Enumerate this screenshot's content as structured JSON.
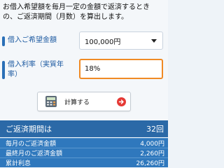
{
  "intro": {
    "line1": "お借入希望額を毎月一定の金額で返済するとき",
    "line2": "の、ご返済期間（月数）を算出します。"
  },
  "loan_amount": {
    "label": "借入ご希望金額",
    "selected_value": "100,000円"
  },
  "rate": {
    "label_line1": "借入利率（実質年",
    "label_line2": "率）",
    "value": "18%"
  },
  "calculate_button": {
    "label": "計算する"
  },
  "result": {
    "title": "ご返済期間は",
    "value": "32回",
    "rows": [
      {
        "label": "毎月のご返済金額",
        "value": "4,000円"
      },
      {
        "label": "最終月のご返済金額",
        "value": "2,260円"
      },
      {
        "label": "累計利息",
        "value": "26,260円"
      }
    ]
  },
  "colors": {
    "accent_blue": "#2a6fb7",
    "header_blue": "#2b69a7",
    "row_blue": "#2f78bd",
    "input_focus_orange": "#f08a24",
    "arrow_red": "#e53935"
  }
}
